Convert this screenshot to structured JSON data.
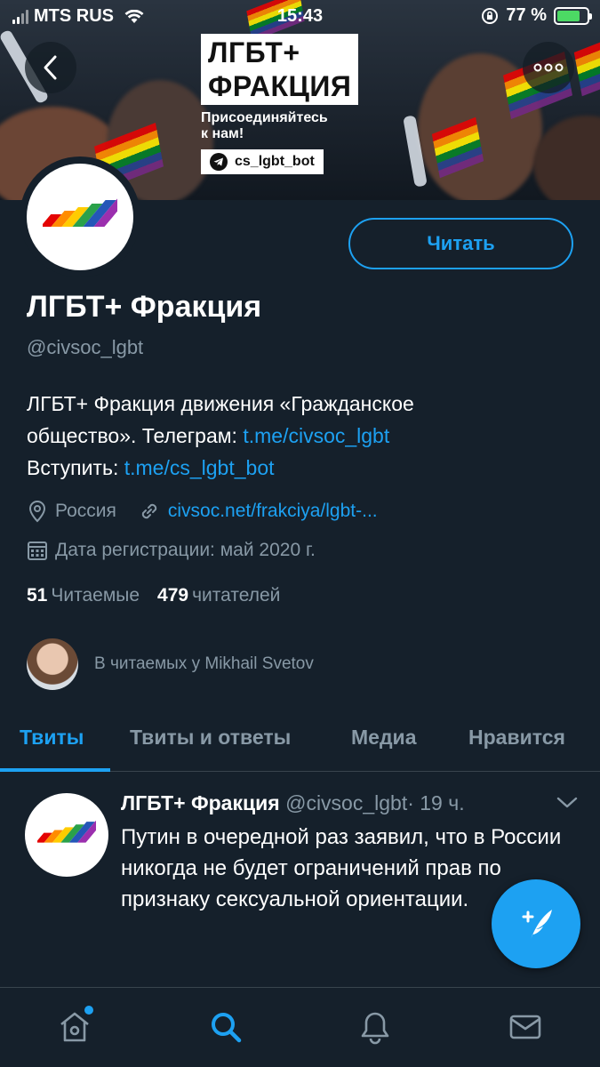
{
  "status_bar": {
    "carrier": "MTS RUS",
    "time": "15:43",
    "battery": "77 %",
    "battery_level": 0.77
  },
  "banner": {
    "title_line1": "ЛГБТ+",
    "title_line2": "ФРАКЦИЯ",
    "subtitle_line1": "Присоединяйтесь",
    "subtitle_line2": "к нам!",
    "bot": "cs_lgbt_bot"
  },
  "profile": {
    "follow_label": "Читать",
    "name": "ЛГБТ+ Фракция",
    "handle": "@civsoc_lgbt",
    "bio_line1": "ЛГБТ+ Фракция движения «Гражданское",
    "bio_line2_prefix": "общество». Телеграм: ",
    "bio_link1": "t.me/civsoc_lgbt",
    "bio_line3_prefix": "Вступить: ",
    "bio_link2": "t.me/cs_lgbt_bot",
    "location": "Россия",
    "website": "civsoc.net/frakciya/lgbt-...",
    "joined": "Дата регистрации: май 2020 г.",
    "following_count": "51",
    "following_label": "Читаемые",
    "followers_count": "479",
    "followers_label": "читателей",
    "followed_by": "В читаемых у Mikhail Svetov"
  },
  "tabs": [
    {
      "label": "Твиты"
    },
    {
      "label": "Твиты и ответы"
    },
    {
      "label": "Медиа"
    },
    {
      "label": "Нравится"
    }
  ],
  "tweet": {
    "author": "ЛГБТ+ Фракция",
    "handle": "@civsoc_lgbt",
    "time": "· 19 ч.",
    "text": "Путин в очередной раз заявил, что в России никогда не будет ограничений прав по признаку сексуальной ориентации."
  },
  "colors": {
    "accent": "#1da1f2",
    "background": "#15202b",
    "muted": "#8899a6"
  },
  "icons": {
    "back": "chevron-left-icon",
    "more": "more-horizontal-icon",
    "location": "location-pin-icon",
    "link": "link-icon",
    "calendar": "calendar-icon",
    "compose": "compose-tweet-icon",
    "home": "home-icon",
    "search": "search-icon",
    "notifications": "bell-icon",
    "messages": "mail-icon"
  }
}
